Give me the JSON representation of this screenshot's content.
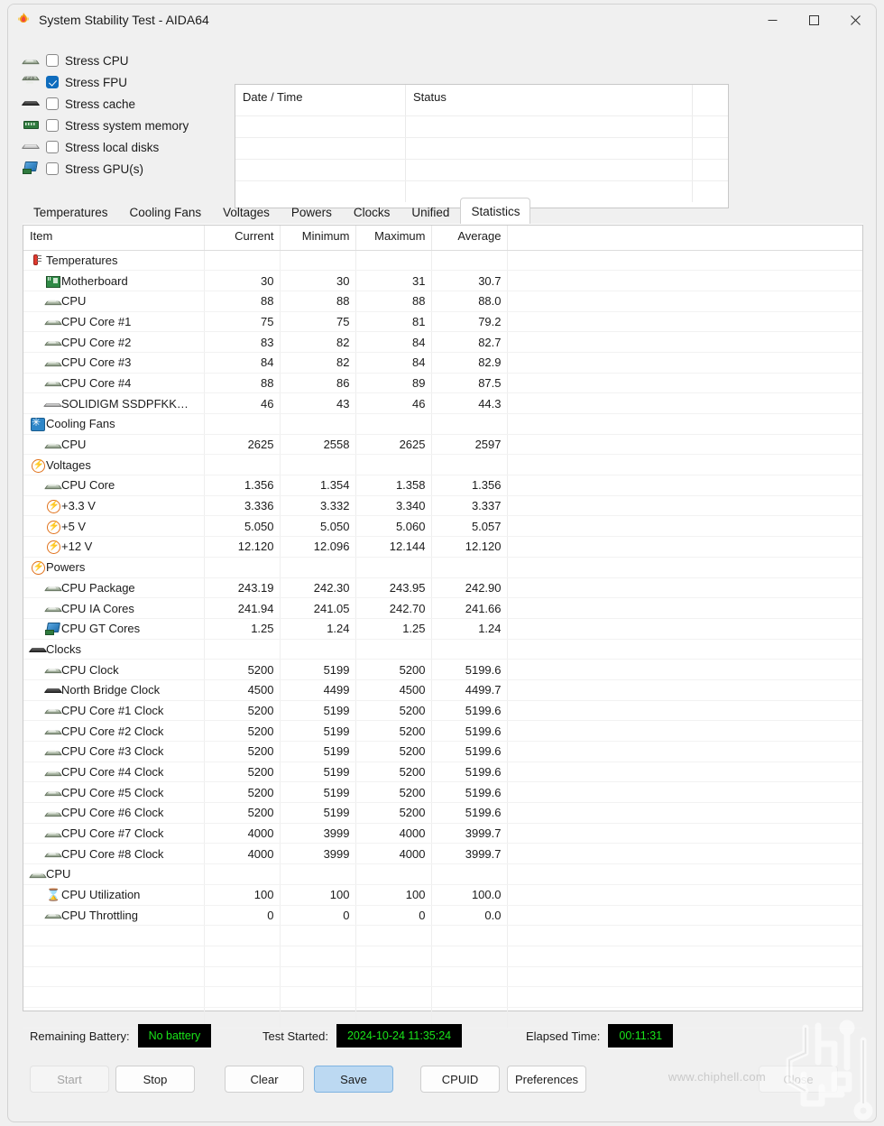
{
  "window": {
    "title": "System Stability Test - AIDA64",
    "app_icon": "flame-icon",
    "minimize": "─",
    "maximize": "☐",
    "close": "✕"
  },
  "stress_options": [
    {
      "label": "Stress CPU",
      "icon": "cpu-icon",
      "checked": false
    },
    {
      "label": "Stress FPU",
      "icon": "fpu-icon",
      "checked": true
    },
    {
      "label": "Stress cache",
      "icon": "cache-icon",
      "checked": false
    },
    {
      "label": "Stress system memory",
      "icon": "memory-icon",
      "checked": false
    },
    {
      "label": "Stress local disks",
      "icon": "disk-icon",
      "checked": false
    },
    {
      "label": "Stress GPU(s)",
      "icon": "gpu-icon",
      "checked": false
    }
  ],
  "log": {
    "columns": [
      "Date / Time",
      "Status",
      ""
    ],
    "rows": []
  },
  "tabs": [
    {
      "label": "Temperatures",
      "active": false
    },
    {
      "label": "Cooling Fans",
      "active": false
    },
    {
      "label": "Voltages",
      "active": false
    },
    {
      "label": "Powers",
      "active": false
    },
    {
      "label": "Clocks",
      "active": false
    },
    {
      "label": "Unified",
      "active": false
    },
    {
      "label": "Statistics",
      "active": true
    }
  ],
  "statistics": {
    "columns": [
      "Item",
      "Current",
      "Minimum",
      "Maximum",
      "Average",
      ""
    ],
    "rows": [
      {
        "type": "group",
        "icon": "thermometer-icon",
        "label": "Temperatures"
      },
      {
        "type": "leaf",
        "icon": "motherboard-icon",
        "label": "Motherboard",
        "current": "30",
        "minimum": "30",
        "maximum": "31",
        "average": "30.7"
      },
      {
        "type": "leaf",
        "icon": "cpu-icon",
        "label": "CPU",
        "current": "88",
        "minimum": "88",
        "maximum": "88",
        "average": "88.0"
      },
      {
        "type": "leaf",
        "icon": "cpu-icon",
        "label": "CPU Core #1",
        "current": "75",
        "minimum": "75",
        "maximum": "81",
        "average": "79.2"
      },
      {
        "type": "leaf",
        "icon": "cpu-icon",
        "label": "CPU Core #2",
        "current": "83",
        "minimum": "82",
        "maximum": "84",
        "average": "82.7"
      },
      {
        "type": "leaf",
        "icon": "cpu-icon",
        "label": "CPU Core #3",
        "current": "84",
        "minimum": "82",
        "maximum": "84",
        "average": "82.9"
      },
      {
        "type": "leaf",
        "icon": "cpu-icon",
        "label": "CPU Core #4",
        "current": "88",
        "minimum": "86",
        "maximum": "89",
        "average": "87.5"
      },
      {
        "type": "leaf",
        "icon": "ssd-icon",
        "label": "SOLIDIGM SSDPFKK…",
        "current": "46",
        "minimum": "43",
        "maximum": "46",
        "average": "44.3"
      },
      {
        "type": "group",
        "icon": "fan-icon",
        "label": "Cooling Fans"
      },
      {
        "type": "leaf",
        "icon": "cpu-icon",
        "label": "CPU",
        "current": "2625",
        "minimum": "2558",
        "maximum": "2625",
        "average": "2597"
      },
      {
        "type": "group",
        "icon": "voltage-icon",
        "label": "Voltages"
      },
      {
        "type": "leaf",
        "icon": "cpu-icon",
        "label": "CPU Core",
        "current": "1.356",
        "minimum": "1.354",
        "maximum": "1.358",
        "average": "1.356"
      },
      {
        "type": "leaf",
        "icon": "voltage-icon",
        "label": "+3.3 V",
        "current": "3.336",
        "minimum": "3.332",
        "maximum": "3.340",
        "average": "3.337"
      },
      {
        "type": "leaf",
        "icon": "voltage-icon",
        "label": "+5 V",
        "current": "5.050",
        "minimum": "5.050",
        "maximum": "5.060",
        "average": "5.057"
      },
      {
        "type": "leaf",
        "icon": "voltage-icon",
        "label": "+12 V",
        "current": "12.120",
        "minimum": "12.096",
        "maximum": "12.144",
        "average": "12.120"
      },
      {
        "type": "group",
        "icon": "voltage-icon",
        "label": "Powers"
      },
      {
        "type": "leaf",
        "icon": "cpu-icon",
        "label": "CPU Package",
        "current": "243.19",
        "minimum": "242.30",
        "maximum": "243.95",
        "average": "242.90"
      },
      {
        "type": "leaf",
        "icon": "cpu-icon",
        "label": "CPU IA Cores",
        "current": "241.94",
        "minimum": "241.05",
        "maximum": "242.70",
        "average": "241.66"
      },
      {
        "type": "leaf",
        "icon": "gpu-icon",
        "label": "CPU GT Cores",
        "current": "1.25",
        "minimum": "1.24",
        "maximum": "1.25",
        "average": "1.24"
      },
      {
        "type": "group",
        "icon": "cache-icon",
        "label": "Clocks"
      },
      {
        "type": "leaf",
        "icon": "cpu-icon",
        "label": "CPU Clock",
        "current": "5200",
        "minimum": "5199",
        "maximum": "5200",
        "average": "5199.6"
      },
      {
        "type": "leaf",
        "icon": "cache-icon",
        "label": "North Bridge Clock",
        "current": "4500",
        "minimum": "4499",
        "maximum": "4500",
        "average": "4499.7"
      },
      {
        "type": "leaf",
        "icon": "cpu-icon",
        "label": "CPU Core #1 Clock",
        "current": "5200",
        "minimum": "5199",
        "maximum": "5200",
        "average": "5199.6"
      },
      {
        "type": "leaf",
        "icon": "cpu-icon",
        "label": "CPU Core #2 Clock",
        "current": "5200",
        "minimum": "5199",
        "maximum": "5200",
        "average": "5199.6"
      },
      {
        "type": "leaf",
        "icon": "cpu-icon",
        "label": "CPU Core #3 Clock",
        "current": "5200",
        "minimum": "5199",
        "maximum": "5200",
        "average": "5199.6"
      },
      {
        "type": "leaf",
        "icon": "cpu-icon",
        "label": "CPU Core #4 Clock",
        "current": "5200",
        "minimum": "5199",
        "maximum": "5200",
        "average": "5199.6"
      },
      {
        "type": "leaf",
        "icon": "cpu-icon",
        "label": "CPU Core #5 Clock",
        "current": "5200",
        "minimum": "5199",
        "maximum": "5200",
        "average": "5199.6"
      },
      {
        "type": "leaf",
        "icon": "cpu-icon",
        "label": "CPU Core #6 Clock",
        "current": "5200",
        "minimum": "5199",
        "maximum": "5200",
        "average": "5199.6"
      },
      {
        "type": "leaf",
        "icon": "cpu-icon",
        "label": "CPU Core #7 Clock",
        "current": "4000",
        "minimum": "3999",
        "maximum": "4000",
        "average": "3999.7"
      },
      {
        "type": "leaf",
        "icon": "cpu-icon",
        "label": "CPU Core #8 Clock",
        "current": "4000",
        "minimum": "3999",
        "maximum": "4000",
        "average": "3999.7"
      },
      {
        "type": "group",
        "icon": "cpu-icon",
        "label": "CPU"
      },
      {
        "type": "leaf",
        "icon": "hourglass-icon",
        "label": "CPU Utilization",
        "current": "100",
        "minimum": "100",
        "maximum": "100",
        "average": "100.0"
      },
      {
        "type": "leaf",
        "icon": "cpu-icon",
        "label": "CPU Throttling",
        "current": "0",
        "minimum": "0",
        "maximum": "0",
        "average": "0.0"
      },
      {
        "type": "empty"
      },
      {
        "type": "empty"
      },
      {
        "type": "empty"
      },
      {
        "type": "empty"
      },
      {
        "type": "empty"
      }
    ]
  },
  "status": {
    "battery_label": "Remaining Battery:",
    "battery_value": "No battery",
    "started_label": "Test Started:",
    "started_value": "2024-10-24 11:35:24",
    "elapsed_label": "Elapsed Time:",
    "elapsed_value": "00:11:31",
    "lcd_color": "#19e519",
    "lcd_bg": "#000000"
  },
  "buttons": [
    {
      "label": "Start",
      "state": "disabled"
    },
    {
      "label": "Stop",
      "state": "normal"
    },
    {
      "label": "Clear",
      "state": "normal"
    },
    {
      "label": "Save",
      "state": "primary"
    },
    {
      "label": "CPUID",
      "state": "normal"
    },
    {
      "label": "Preferences",
      "state": "normal"
    },
    {
      "label": "Close",
      "state": "normal"
    }
  ],
  "watermark": {
    "text": "www.chiphell.com",
    "logo": "chiphell-logo"
  }
}
